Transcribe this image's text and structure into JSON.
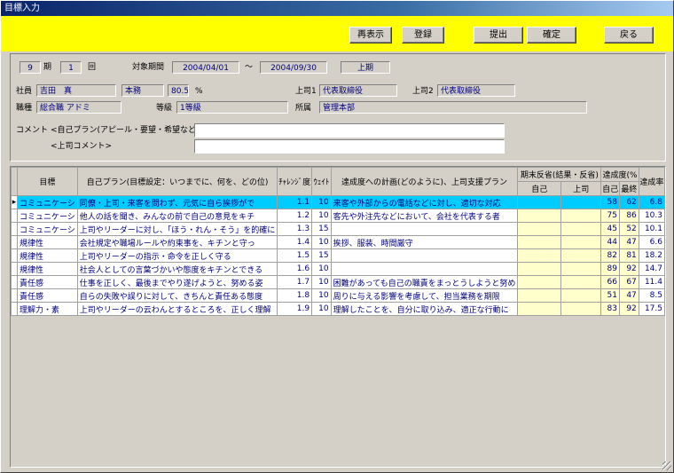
{
  "window": {
    "title": "目標入力"
  },
  "toolbar": {
    "redisplay": "再表示",
    "register": "登録",
    "submit": "提出",
    "confirm": "確定",
    "back": "戻る"
  },
  "period": {
    "term_value": "9",
    "term_unit": "期",
    "round_value": "1",
    "round_unit": "回",
    "range_label": "対象期間",
    "start": "2004/04/01",
    "tilde": "～",
    "end": "2004/09/30",
    "half": "上期"
  },
  "employee": {
    "label": "社員",
    "name": "吉田　真",
    "dept": "本務",
    "ratio": "80.5",
    "percent": "%",
    "boss1_label": "上司1",
    "boss1": "代表取締役",
    "boss2_label": "上司2",
    "boss2": "代表取締役",
    "job_label": "職種",
    "job": "総合職 アドミ",
    "grade_label": "等級",
    "grade": "1等級",
    "org_label": "所属",
    "org": "管理本部"
  },
  "comments": {
    "title": "コメント",
    "self_label": "<自己プラン(アピール・要望・希望など)>",
    "boss_label": "<上司コメント>",
    "self_value": "",
    "boss_value": ""
  },
  "grid": {
    "headers": {
      "goal": "目標",
      "self_plan": "自己プラン(目標設定：いつまでに、何を、どの位)",
      "challenge": "ﾁｬﾚﾝｼﾞ度",
      "weight": "ｳｪｲﾄ",
      "achievement_plan": "達成度への計画(どのように)、上司支援プラン",
      "reflection_group": "期末反省(結果・反省)",
      "self": "自己",
      "boss": "上司",
      "degree_group": "達成度(%",
      "deg_self": "自己",
      "deg_final": "最終",
      "rate": "達成率"
    },
    "rows": [
      {
        "goal": "コミュニケーシ",
        "plan": "同僚・上司・来客を問わず、元気に自ら挨拶がで",
        "challenge": "1.1",
        "weight": "10",
        "achieve": "来客や外部からの電話などに対し、適切な対応",
        "ref_self": "",
        "ref_boss": "",
        "deg_self": "58",
        "deg_final": "62",
        "rate": "6.8",
        "active": true
      },
      {
        "goal": "コミュニケーシ",
        "plan": "他人の話を聞き、みんなの前で自己の意見をキチ",
        "challenge": "1.2",
        "weight": "10",
        "achieve": "客先や外注先などにおいて、会社を代表する者",
        "ref_self": "",
        "ref_boss": "",
        "deg_self": "75",
        "deg_final": "86",
        "rate": "10.3"
      },
      {
        "goal": "コミュニケーシ",
        "plan": "上司やリーダーに対し、「ほう・れん・そう」を的確に",
        "challenge": "1.3",
        "weight": "15",
        "achieve": "",
        "ref_self": "",
        "ref_boss": "",
        "deg_self": "45",
        "deg_final": "52",
        "rate": "10.1"
      },
      {
        "goal": "規律性",
        "plan": "会社規定や職場ルールや約束事を、キチンと守っ",
        "challenge": "1.4",
        "weight": "10",
        "achieve": "挨拶、服装、時間厳守",
        "ref_self": "",
        "ref_boss": "",
        "deg_self": "44",
        "deg_final": "47",
        "rate": "6.6"
      },
      {
        "goal": "規律性",
        "plan": "上司やリーダーの指示・命令を正しく守る",
        "challenge": "1.5",
        "weight": "15",
        "achieve": "",
        "ref_self": "",
        "ref_boss": "",
        "deg_self": "82",
        "deg_final": "81",
        "rate": "18.2"
      },
      {
        "goal": "規律性",
        "plan": "社会人としての言葉づかいや態度をキチンとできる",
        "challenge": "1.6",
        "weight": "10",
        "achieve": "",
        "ref_self": "",
        "ref_boss": "",
        "deg_self": "89",
        "deg_final": "92",
        "rate": "14.7"
      },
      {
        "goal": "責任感",
        "plan": "仕事を正しく、最後までやり遂げようと、努める姿",
        "challenge": "1.7",
        "weight": "10",
        "achieve": "困難があっても自己の職責をまっとうしようと努め",
        "ref_self": "",
        "ref_boss": "",
        "deg_self": "66",
        "deg_final": "67",
        "rate": "11.4"
      },
      {
        "goal": "責任感",
        "plan": "自らの失敗や誤りに対して、きちんと責任ある態度",
        "challenge": "1.8",
        "weight": "10",
        "achieve": "周りに与える影響を考慮して、担当業務を期限",
        "ref_self": "",
        "ref_boss": "",
        "deg_self": "51",
        "deg_final": "47",
        "rate": "8.5"
      },
      {
        "goal": "理解力・素",
        "plan": "上司やリーダーの云わんとするところを、正しく理解",
        "challenge": "1.9",
        "weight": "10",
        "achieve": "理解したことを、自分に取り込み、適正な行動に",
        "ref_self": "",
        "ref_boss": "",
        "deg_self": "83",
        "deg_final": "92",
        "rate": "17.5"
      }
    ]
  }
}
